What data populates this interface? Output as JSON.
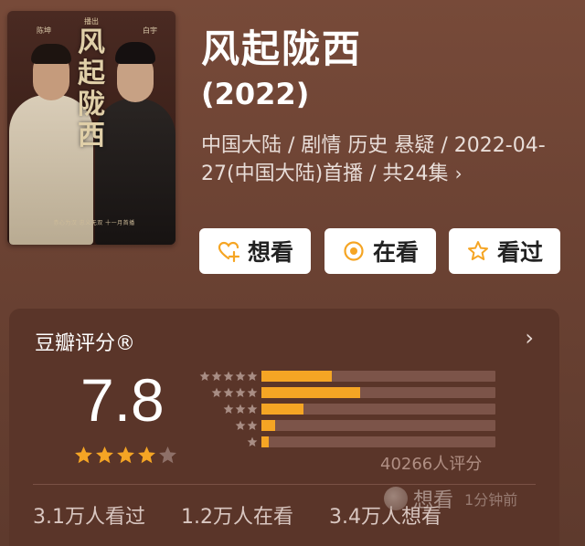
{
  "poster": {
    "title_art": "风起陇西",
    "tag_small": "播出",
    "cast_left": "陈坤",
    "cast_right": "白宇",
    "tagline": "赤心为汉 忠义无双 十一月首播"
  },
  "header": {
    "title": "风起陇西",
    "year": "(2022)",
    "meta": "中国大陆 / 剧情 历史 悬疑 / 2022-04-27(中国大陆)首播 / 共24集",
    "meta_chevron": "›"
  },
  "actions": [
    {
      "label": "想看",
      "icon": "heart-plus-icon"
    },
    {
      "label": "在看",
      "icon": "target-icon"
    },
    {
      "label": "看过",
      "icon": "star-outline-icon"
    }
  ],
  "colors": {
    "accent": "#f5a524",
    "background": "#6b4233",
    "card": "#5a3529",
    "track": "#7c5449"
  },
  "rating": {
    "title": "豆瓣评分®",
    "chevron": "›",
    "score": "7.8",
    "stars_filled": 4,
    "stars_total": 5,
    "distribution": [
      {
        "stars": 5,
        "fraction": 0.3
      },
      {
        "stars": 4,
        "fraction": 0.42
      },
      {
        "stars": 3,
        "fraction": 0.18
      },
      {
        "stars": 2,
        "fraction": 0.06
      },
      {
        "stars": 1,
        "fraction": 0.03
      }
    ],
    "raters": "40266人评分",
    "stats": {
      "watched": "3.1万人看过",
      "watching": "1.2万人在看",
      "want": "3.4万人想看"
    }
  },
  "toast": {
    "action": "想看",
    "time": "1分钟前"
  }
}
